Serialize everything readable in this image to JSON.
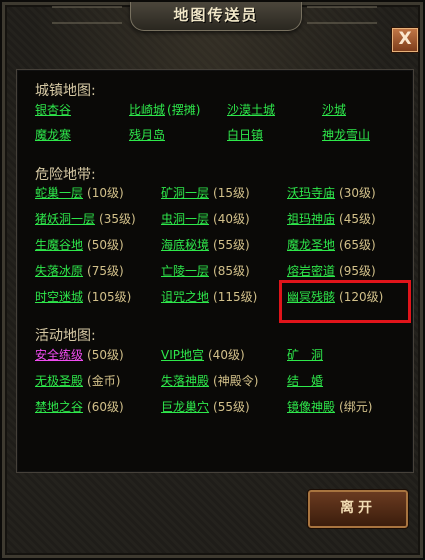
{
  "window": {
    "title": "地图传送员",
    "close_label": "X",
    "leave_label": "离开"
  },
  "sections": {
    "town": {
      "title": "城镇地图:",
      "items": [
        {
          "name": "银杏谷"
        },
        {
          "name": "比崎城",
          "note": "(摆摊)"
        },
        {
          "name": "沙漠土城"
        },
        {
          "name": "沙城"
        },
        {
          "name": "魔龙寨"
        },
        {
          "name": "残月岛"
        },
        {
          "name": "白日镇"
        },
        {
          "name": "神龙雪山"
        }
      ]
    },
    "danger": {
      "title": "危险地带:",
      "items": [
        {
          "name": "蛇巢一层",
          "level": "(10级)"
        },
        {
          "name": "矿洞一层",
          "level": "(15级)"
        },
        {
          "name": "沃玛寺庙",
          "level": "(30级)"
        },
        {
          "name": "猪妖洞一层",
          "level": "(35级)"
        },
        {
          "name": "虫洞一层",
          "level": "(40级)"
        },
        {
          "name": "祖玛神庙",
          "level": "(45级)"
        },
        {
          "name": "生魔谷地",
          "level": "(50级)"
        },
        {
          "name": "海底秘境",
          "level": "(55级)"
        },
        {
          "name": "魔龙圣地",
          "level": "(65级)"
        },
        {
          "name": "失落冰原",
          "level": "(75级)"
        },
        {
          "name": "亡陵一层",
          "level": "(85级)"
        },
        {
          "name": "熔岩密道",
          "level": "(95级)"
        },
        {
          "name": "时空迷城",
          "level": "(105级)"
        },
        {
          "name": "诅咒之地",
          "level": "(115级)"
        },
        {
          "name": "幽冥残骸",
          "level": "(120级)"
        }
      ]
    },
    "event": {
      "title": "活动地图:",
      "items": [
        {
          "name": "安全练级",
          "level": "(50级)"
        },
        {
          "name": "VIP地宫",
          "level": "(40级)"
        },
        {
          "name": "矿　洞"
        },
        {
          "name": "无极圣殿",
          "level": "(金币)"
        },
        {
          "name": "失落神殿",
          "level": "(神殿令)"
        },
        {
          "name": "结　婚"
        },
        {
          "name": "禁地之谷",
          "level": "(60级)"
        },
        {
          "name": "巨龙巢穴",
          "level": "(55级)"
        },
        {
          "name": "镜像神殿",
          "level": "(绑元)"
        }
      ]
    }
  },
  "colors": {
    "link_green": "#2ee84b",
    "link_magenta": "#f04cf0",
    "level_tan": "#d2c08a",
    "highlight_red": "#e0141a"
  }
}
